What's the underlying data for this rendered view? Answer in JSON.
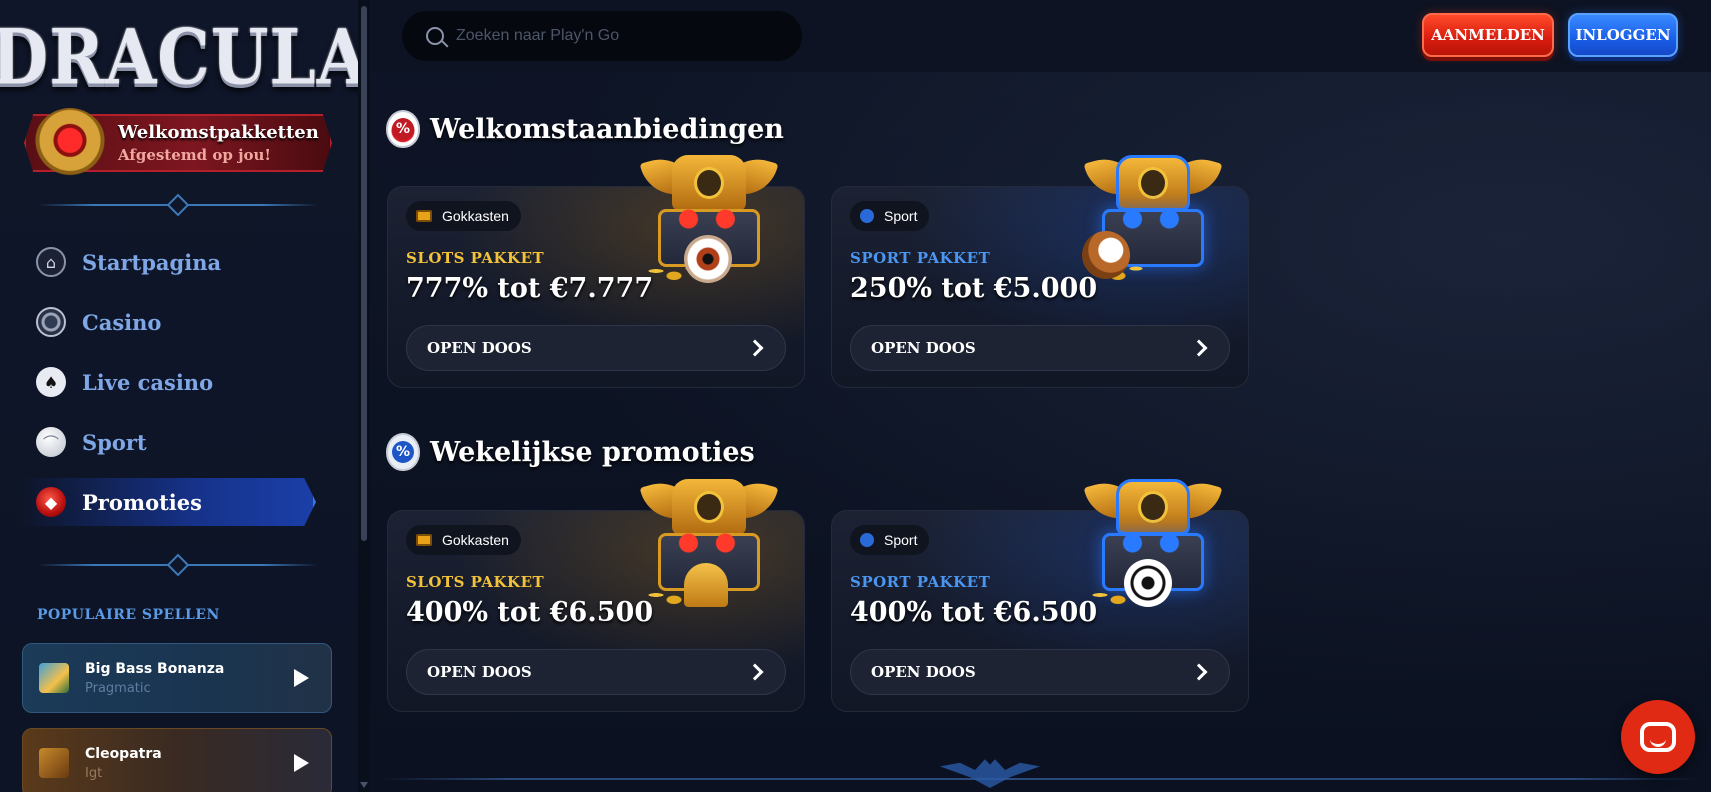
{
  "brand": {
    "logo_text": "DRACULA"
  },
  "sidebar": {
    "welcome": {
      "title": "Welkomstpakketten",
      "subtitle": "Afgestemd op jou!"
    },
    "items": [
      {
        "label": "Startpagina",
        "icon": "home-icon"
      },
      {
        "label": "Casino",
        "icon": "casino-chip-icon"
      },
      {
        "label": "Live casino",
        "icon": "cards-icon"
      },
      {
        "label": "Sport",
        "icon": "baseball-icon"
      },
      {
        "label": "Promoties",
        "icon": "gem-icon",
        "active": true
      }
    ],
    "popular_title": "POPULAIRE SPELLEN",
    "games": [
      {
        "name": "Big Bass Bonanza",
        "provider": "Pragmatic"
      },
      {
        "name": "Cleopatra",
        "provider": "Igt"
      }
    ]
  },
  "header": {
    "search_placeholder": "Zoeken naar Play'n Go",
    "register_label": "AANMELDEN",
    "login_label": "INLOGGEN"
  },
  "main": {
    "sections": [
      {
        "title": "Welkomstaanbiedingen",
        "cards": [
          {
            "category": "Gokkasten",
            "package": "SLOTS PAKKET",
            "amount": "777% tot €7.777",
            "button": "OPEN DOOS"
          },
          {
            "category": "Sport",
            "package": "SPORT PAKKET",
            "amount": "250% tot €5.000",
            "button": "OPEN DOOS"
          }
        ]
      },
      {
        "title": "Wekelijkse promoties",
        "cards": [
          {
            "category": "Gokkasten",
            "package": "SLOTS PAKKET",
            "amount": "400% tot €6.500",
            "button": "OPEN DOOS"
          },
          {
            "category": "Sport",
            "package": "SPORT PAKKET",
            "amount": "400% tot €6.500",
            "button": "OPEN DOOS"
          }
        ]
      }
    ]
  },
  "colors": {
    "background": "#0b1020",
    "accent_red": "#d81c0e",
    "accent_blue": "#1a5ee8",
    "slots_gold": "#f2c23a",
    "sport_blue": "#4a96f0",
    "nav_text": "#7fa7e6"
  }
}
